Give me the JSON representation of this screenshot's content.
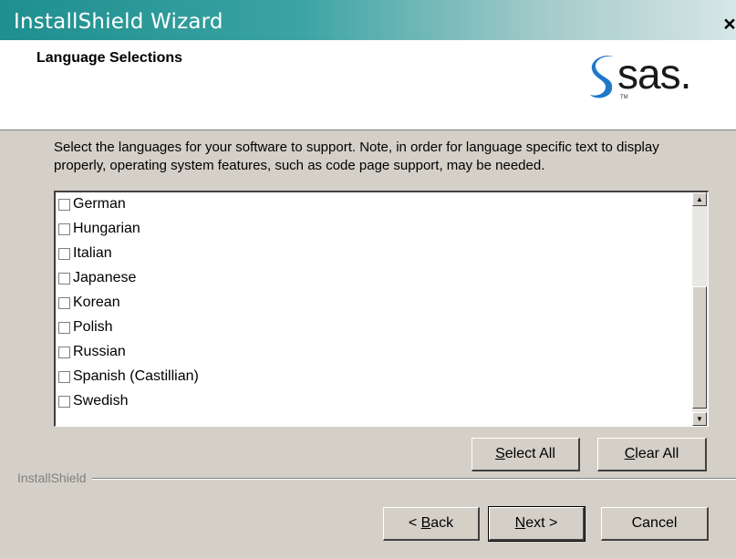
{
  "window": {
    "title": "InstallShield Wizard",
    "close_label": "×"
  },
  "header": {
    "title": "Language Selections",
    "logo_text": "sas.",
    "logo_tm": "TM",
    "logo_color": "#1f78c8"
  },
  "description": "Select the languages for your software to support.  Note, in order for language specific text to display properly, operating system features, such as code page support, may be needed.",
  "languages": [
    {
      "label": "German",
      "checked": false
    },
    {
      "label": "Hungarian",
      "checked": false
    },
    {
      "label": "Italian",
      "checked": false
    },
    {
      "label": "Japanese",
      "checked": false
    },
    {
      "label": "Korean",
      "checked": false
    },
    {
      "label": "Polish",
      "checked": false
    },
    {
      "label": "Russian",
      "checked": false
    },
    {
      "label": "Spanish (Castillian)",
      "checked": false
    },
    {
      "label": "Swedish",
      "checked": false
    }
  ],
  "scrollbar": {
    "up_icon": "▲",
    "down_icon": "▼"
  },
  "buttons": {
    "select_all": {
      "mnemonic": "S",
      "rest": "elect All"
    },
    "clear_all": {
      "mnemonic": "C",
      "rest": "lear All"
    },
    "back": {
      "prefix": "< ",
      "mnemonic": "B",
      "rest": "ack"
    },
    "next": {
      "mnemonic": "N",
      "rest": "ext >"
    },
    "cancel": {
      "label": "Cancel"
    }
  },
  "footer": {
    "brand": "InstallShield"
  }
}
